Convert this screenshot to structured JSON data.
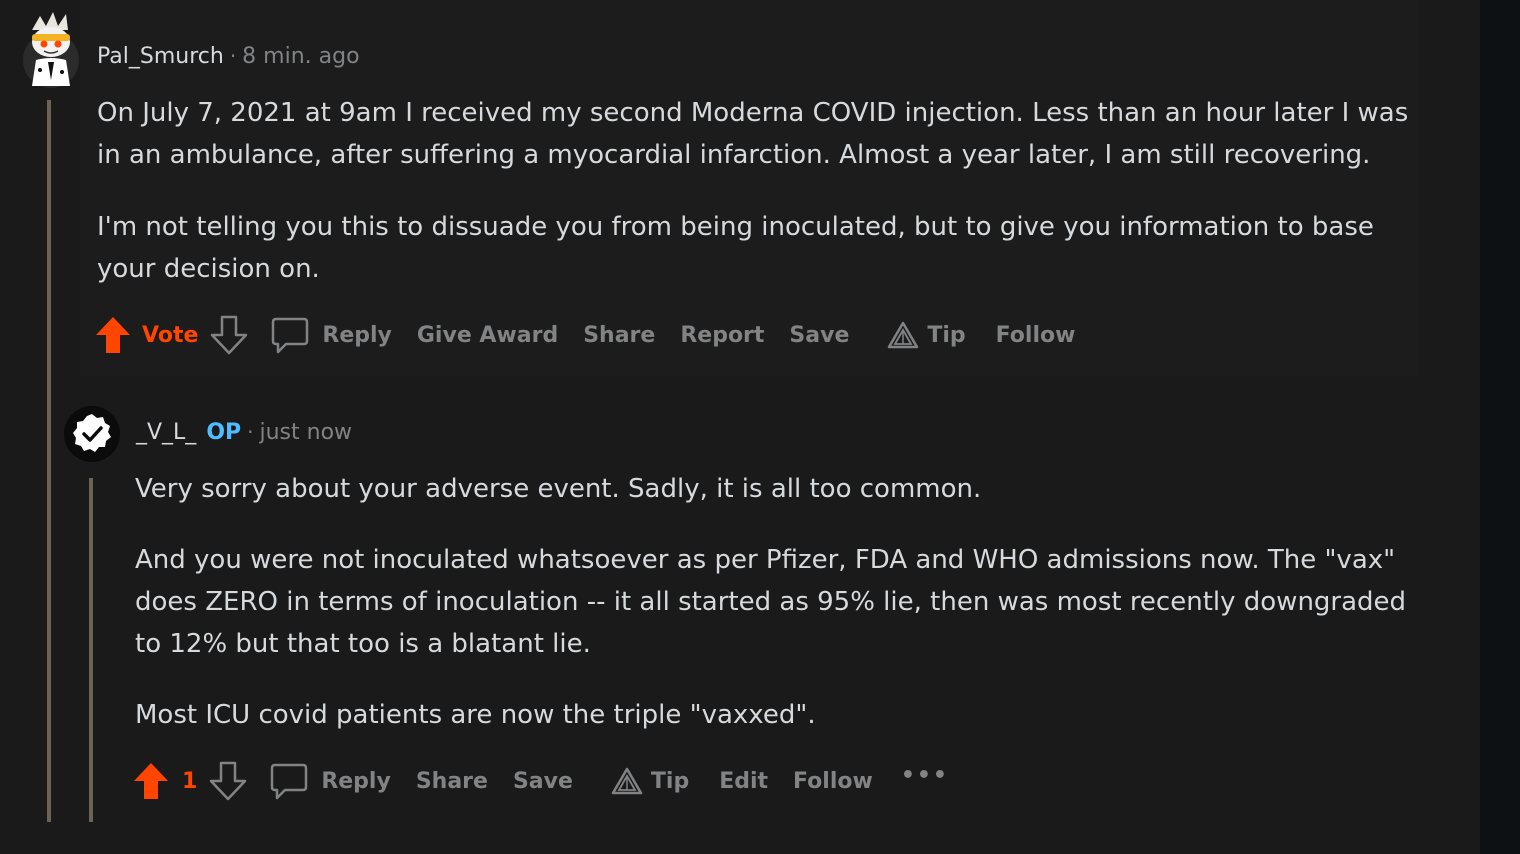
{
  "colors": {
    "background": "#1a1a1b",
    "text": "#d7dadc",
    "muted": "#818384",
    "upvote": "#ff4500",
    "op_badge": "#4fbcff",
    "thread_line": "#6b6455"
  },
  "comments": [
    {
      "username": "Pal_Smurch",
      "dot": "·",
      "time": "8 min. ago",
      "paragraphs": [
        "On July 7, 2021 at 9am I received my second Moderna COVID injection. Less than an hour later I was in an ambulance, after suffering a myocardial infarction. Almost a year later, I am still recovering.",
        "I'm not telling you this to dissuade you from being inoculated, but to give you information to base your decision on."
      ],
      "actions": {
        "vote": "Vote",
        "reply": "Reply",
        "give_award": "Give Award",
        "share": "Share",
        "report": "Report",
        "save": "Save",
        "tip": "Tip",
        "follow": "Follow"
      },
      "icons": [
        "upvote-icon",
        "downvote-icon",
        "comment-bubble-icon",
        "tip-triangle-icon"
      ]
    },
    {
      "username": "_V_L_",
      "op": "OP",
      "dot": "·",
      "time": "just now",
      "paragraphs": [
        "Very sorry about your adverse event. Sadly, it is all too common.",
        "And you were not inoculated whatsoever as per Pfizer, FDA and WHO admissions now. The \"vax\" does ZERO in terms of inoculation -- it all started as 95% lie, then was most recently downgraded to 12% but that too is a blatant lie.",
        "Most ICU covid patients are now the triple \"vaxxed\"."
      ],
      "actions": {
        "score": "1",
        "reply": "Reply",
        "share": "Share",
        "save": "Save",
        "tip": "Tip",
        "edit": "Edit",
        "follow": "Follow",
        "more": "•••"
      },
      "icons": [
        "upvote-icon",
        "downvote-icon",
        "comment-bubble-icon",
        "tip-triangle-icon",
        "more-options-icon",
        "verified-check-icon"
      ]
    }
  ]
}
